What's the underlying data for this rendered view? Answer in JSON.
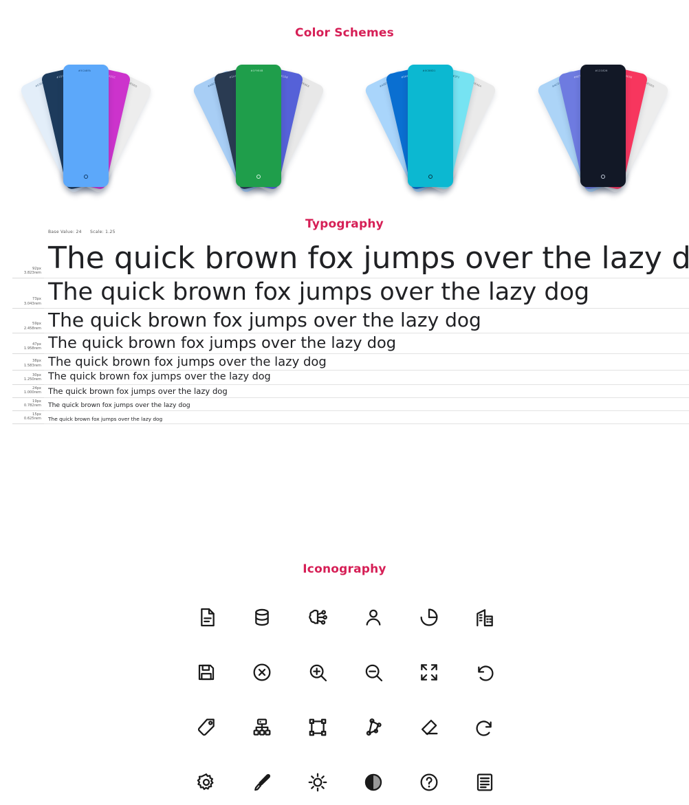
{
  "sections": {
    "colors_title": "Color Schemes",
    "typography_title": "Typography",
    "iconography_title": "Iconography"
  },
  "color_schemes": [
    {
      "name": "scheme-blue-magenta",
      "cards": [
        {
          "hex": "#E3EEF9",
          "text_color": "#4a6b8a"
        },
        {
          "hex": "#1D3B5C",
          "text_color": "#cfe0f0"
        },
        {
          "hex": "#5CA8FA",
          "text_color": "#103a66"
        },
        {
          "hex": "#CC33CC",
          "text_color": "#ffe3ff"
        },
        {
          "hex": "#EDEDED",
          "text_color": "#6b6b6b"
        }
      ]
    },
    {
      "name": "scheme-green",
      "cards": [
        {
          "hex": "#A8CEF5",
          "text_color": "#2d5a86"
        },
        {
          "hex": "#2A3B52",
          "text_color": "#cddcec"
        },
        {
          "hex": "#1F9E4B",
          "text_color": "#d8f5e3"
        },
        {
          "hex": "#5561D8",
          "text_color": "#e0e3ff"
        },
        {
          "hex": "#E8E8E8",
          "text_color": "#6b6b6b"
        }
      ]
    },
    {
      "name": "scheme-cyan",
      "cards": [
        {
          "hex": "#A9D5FB",
          "text_color": "#2d5a86"
        },
        {
          "hex": "#0A6FD1",
          "text_color": "#d6e9ff"
        },
        {
          "hex": "#0CB8D1",
          "text_color": "#063642"
        },
        {
          "hex": "#76E3F2",
          "text_color": "#0a5563"
        },
        {
          "hex": "#EAEAEA",
          "text_color": "#6b6b6b"
        }
      ]
    },
    {
      "name": "scheme-dark-red",
      "cards": [
        {
          "hex": "#ACD4F7",
          "text_color": "#2d5a86"
        },
        {
          "hex": "#6E7BE0",
          "text_color": "#e8eaff"
        },
        {
          "hex": "#121826",
          "text_color": "#c3ccdb"
        },
        {
          "hex": "#F7365E",
          "text_color": "#ffe2e8"
        },
        {
          "hex": "#EDEDED",
          "text_color": "#6b6b6b"
        }
      ]
    }
  ],
  "typography": {
    "base_label": "Base Value: 24",
    "scale_label": "Scale: 1.25",
    "sample_text": "The quick brown fox jumps over the lazy dog",
    "rows": [
      {
        "px": "92px",
        "rem": "3.823rem",
        "size": 44
      },
      {
        "px": "73px",
        "rem": "3.043rem",
        "size": 35
      },
      {
        "px": "59px",
        "rem": "2.458rem",
        "size": 28
      },
      {
        "px": "47px",
        "rem": "1.958rem",
        "size": 22.5
      },
      {
        "px": "38px",
        "rem": "1.583rem",
        "size": 18
      },
      {
        "px": "30px",
        "rem": "1.250rem",
        "size": 14.4
      },
      {
        "px": "24px",
        "rem": "1.000rem",
        "size": 11.6
      },
      {
        "px": "19px",
        "rem": "0.782rem",
        "size": 9.2
      },
      {
        "px": "15px",
        "rem": "0.625rem",
        "size": 7.4
      }
    ]
  },
  "icons": [
    [
      {
        "name": "document-icon",
        "label": "Document"
      },
      {
        "name": "database-icon",
        "label": "Database"
      },
      {
        "name": "brain-icon",
        "label": "Model"
      },
      {
        "name": "user-icon",
        "label": "User"
      },
      {
        "name": "pie-chart-icon",
        "label": "Chart"
      },
      {
        "name": "building-icon",
        "label": "Organization"
      }
    ],
    [
      {
        "name": "save-icon",
        "label": "Save"
      },
      {
        "name": "close-circle-icon",
        "label": "Close"
      },
      {
        "name": "zoom-in-icon",
        "label": "Zoom In"
      },
      {
        "name": "zoom-out-icon",
        "label": "Zoom Out"
      },
      {
        "name": "fullscreen-icon",
        "label": "Fit Screen"
      },
      {
        "name": "undo-icon",
        "label": "Undo"
      }
    ],
    [
      {
        "name": "tag-icon",
        "label": "Tag"
      },
      {
        "name": "hierarchy-icon",
        "label": "Hierarchy"
      },
      {
        "name": "selection-box-icon",
        "label": "Select"
      },
      {
        "name": "polygon-icon",
        "label": "Polygon"
      },
      {
        "name": "eraser-icon",
        "label": "Eraser"
      },
      {
        "name": "redo-icon",
        "label": "Redo"
      }
    ],
    [
      {
        "name": "settings-icon",
        "label": "Settings"
      },
      {
        "name": "brush-icon",
        "label": "Brush"
      },
      {
        "name": "brightness-icon",
        "label": "Brightness"
      },
      {
        "name": "contrast-icon",
        "label": "Contrast"
      },
      {
        "name": "help-icon",
        "label": "Help"
      },
      {
        "name": "list-icon",
        "label": "List"
      }
    ]
  ]
}
